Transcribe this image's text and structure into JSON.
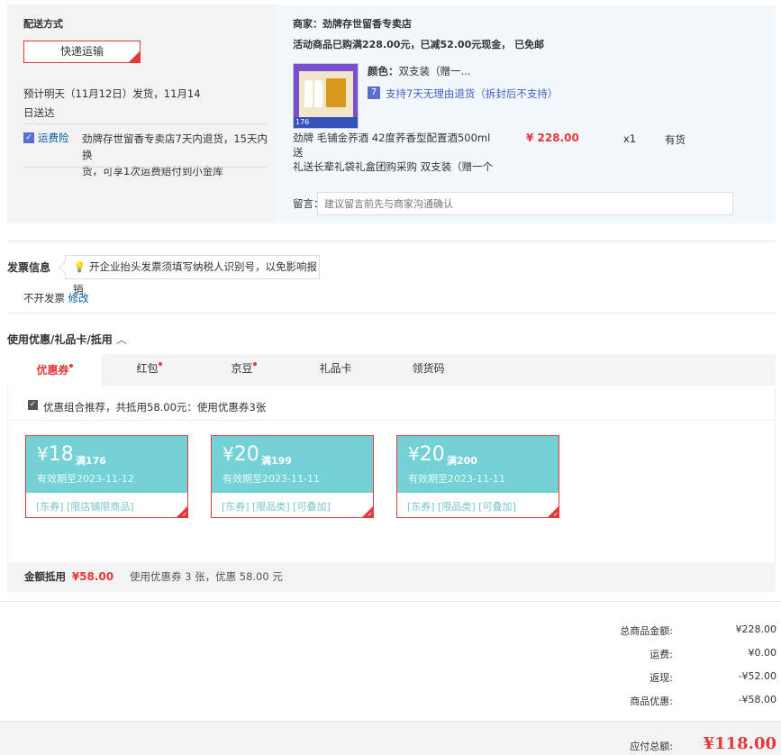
{
  "shipping": {
    "title": "配送方式",
    "method": "快递运输",
    "eta_line1": "预计明天（11月12日）发货，11月14",
    "eta_line2": "日送达",
    "insurance_label": "运费险",
    "insurance_icon": "shield-icon",
    "insurance_line1": "劲牌存世留香专卖店7天内退货，15天内换",
    "insurance_line2": "货，可享1次运费赔付到小金库"
  },
  "vendor": {
    "store": "商家：劲牌存世留香专卖店",
    "promo": "活动商品已购满228.00元，已减52.00元现金， 已免邮",
    "product_tag": "176",
    "color_label": "颜色：",
    "color_value": "双支装（赠一...",
    "return_policy": "支持7天无理由退货（拆封后不支持）",
    "product_name_line1": "劲牌 毛铺金荞酒 42度荞香型配置酒500ml 送",
    "product_name_line2": "礼送长辈礼袋礼盒团购采购 双支装（赠一个",
    "price": "¥ 228.00",
    "quantity": "x1",
    "stock": "有货",
    "message_label": "留言：",
    "message_placeholder": "建议留言前先与商家沟通确认"
  },
  "invoice": {
    "title": "发票信息",
    "tip": "开企业抬头发票须填写纳税人识别号，以免影响报销",
    "status": "不开发票",
    "edit": "修改"
  },
  "discounts": {
    "title": "使用优惠/礼品卡/抵用",
    "tabs": [
      {
        "label": "优惠券",
        "dot": true
      },
      {
        "label": "红包",
        "dot": true
      },
      {
        "label": "京豆",
        "dot": true
      },
      {
        "label": "礼品卡",
        "dot": false
      },
      {
        "label": "领货码",
        "dot": false
      }
    ],
    "combo_text": "优惠组合推荐，共抵用58.00元：使用优惠券3张",
    "coupons": [
      {
        "currency": "¥",
        "amount": "18",
        "limit": "满176",
        "expiry": "有效期至2023-11-12",
        "tags": "[东券]  [限店铺限商品]"
      },
      {
        "currency": "¥",
        "amount": "20",
        "limit": "满199",
        "expiry": "有效期至2023-11-11",
        "tags": "[东券]  [限品类]  [可叠加]"
      },
      {
        "currency": "¥",
        "amount": "20",
        "limit": "满200",
        "expiry": "有效期至2023-11-11",
        "tags": "[东券]  [限品类]  [可叠加]"
      }
    ],
    "deduct_label": "金额抵用",
    "deduct_amount": "¥58.00",
    "deduct_desc": "使用优惠券 3 张，优惠 58.00 元"
  },
  "summary": {
    "rows": [
      {
        "label": "总商品金额:",
        "value": "¥228.00"
      },
      {
        "label": "运费:",
        "value": "¥0.00"
      },
      {
        "label": "返现:",
        "value": "-¥52.00"
      },
      {
        "label": "商品优惠:",
        "value": "-¥58.00"
      }
    ],
    "total_label": "应付总额:",
    "total_value": "¥118.00"
  },
  "colors": {
    "accent": "#e4393c",
    "coupon": "#74d2d6",
    "link": "#005ea7"
  }
}
